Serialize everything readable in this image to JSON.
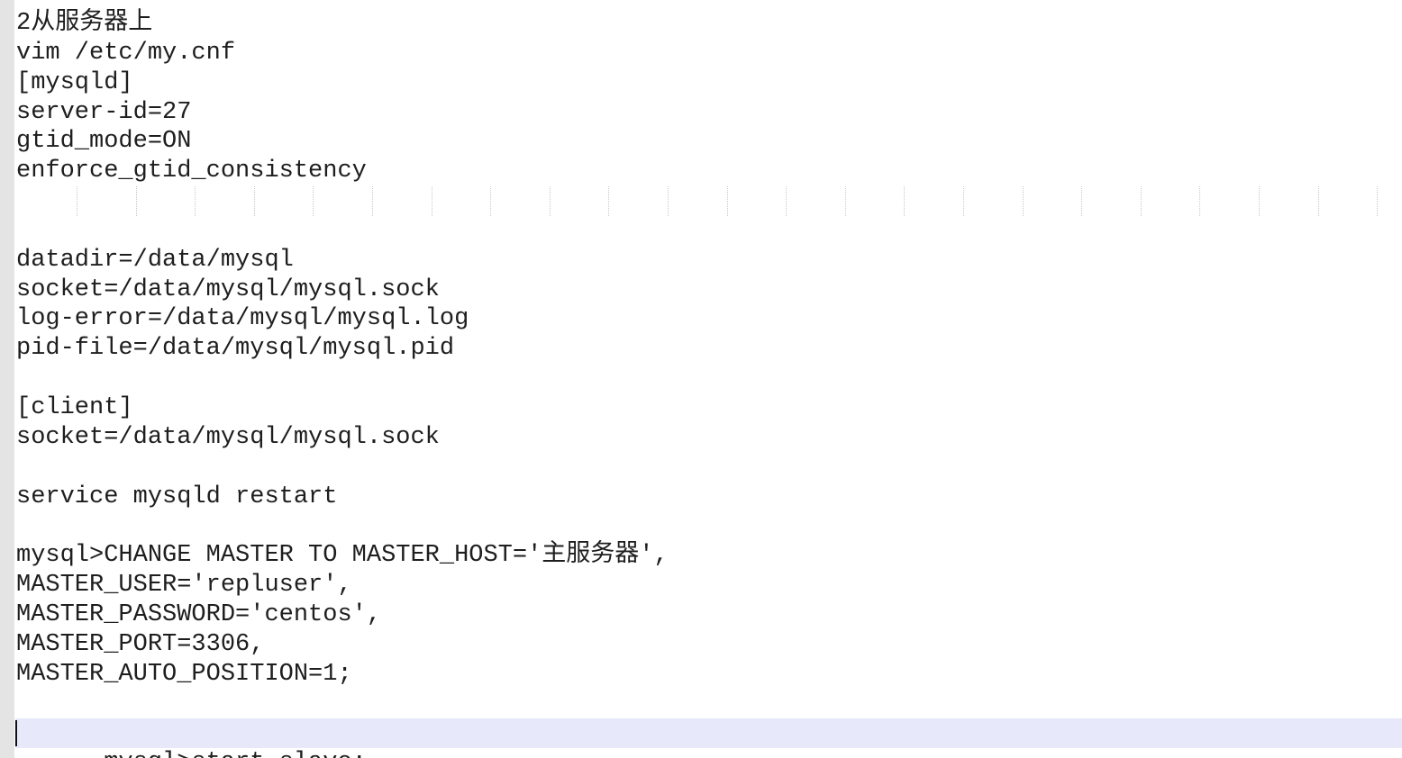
{
  "editor": {
    "lines": [
      "2从服务器上",
      "vim /etc/my.cnf",
      "[mysqld]",
      "server-id=27",
      "gtid_mode=ON",
      "enforce_gtid_consistency",
      "",
      "",
      "datadir=/data/mysql",
      "socket=/data/mysql/mysql.sock",
      "log-error=/data/mysql/mysql.log",
      "pid-file=/data/mysql/mysql.pid",
      "",
      "[client]",
      "socket=/data/mysql/mysql.sock",
      "",
      "service mysqld restart",
      "",
      "mysql>CHANGE MASTER TO MASTER_HOST='主服务器',",
      "MASTER_USER='repluser',",
      "MASTER_PASSWORD='centos',",
      "MASTER_PORT=3306,",
      "MASTER_AUTO_POSITION=1;",
      "",
      "mysql>start slave;"
    ],
    "current_line": 24,
    "whitespace_line": 6
  }
}
